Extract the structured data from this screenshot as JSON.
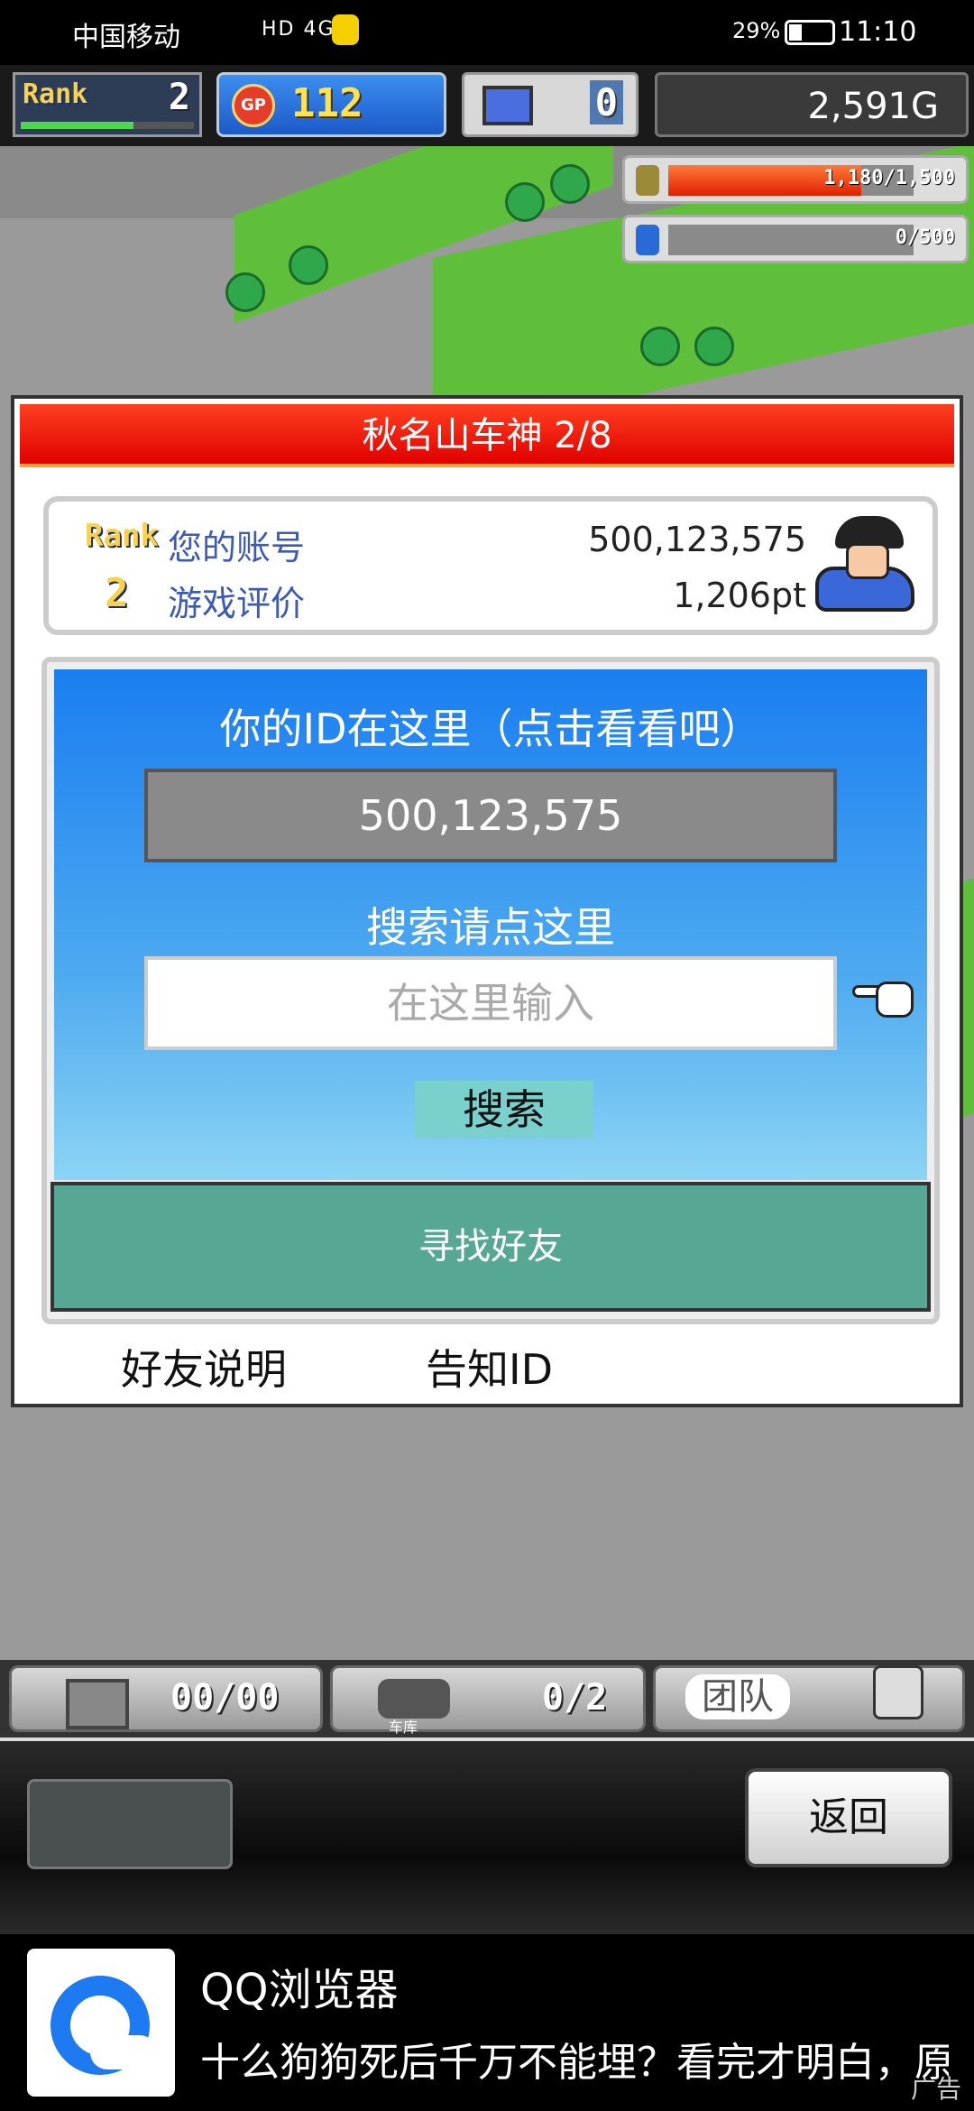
{
  "status_bar": {
    "carrier": "中国移动",
    "signal": "HD 4G",
    "battery": "29%",
    "time": "11:10"
  },
  "hud": {
    "rank_label": "Rank",
    "rank_value": "2",
    "rank_progress": 0.65,
    "gp_label": "GP",
    "gp_value": "112",
    "pc_value": "0",
    "gold": "2,591G"
  },
  "resources": [
    {
      "name": "fuel",
      "value": "1,180/1,500",
      "fraction": 0.787,
      "color": "#e02000"
    },
    {
      "name": "energy",
      "value": "0/500",
      "fraction": 0,
      "color": "#e02000"
    }
  ],
  "dialog": {
    "title": "秋名山车神 2/8",
    "rank_label": "Rank",
    "rank_value": "2",
    "account_label": "您的账号",
    "account_value": "500,123,575",
    "rating_label": "游戏评价",
    "rating_value": "1,206pt",
    "id_prompt": "你的ID在这里（点击看看吧）",
    "id_value": "500,123,575",
    "search_prompt": "搜索请点这里",
    "search_placeholder": "在这里输入",
    "search_button": "搜索",
    "find_friend_button": "寻找好友",
    "friend_help_link": "好友说明",
    "share_id_link": "告知ID"
  },
  "bottom": {
    "storage_value": "00/00",
    "garage_label": "车库",
    "garage_value": "0/2",
    "team_label": "团队",
    "back_button": "返回"
  },
  "ad": {
    "title": "QQ浏览器",
    "text": "十么狗狗死后千万不能埋？看完才明白，原来",
    "tag": "广告"
  }
}
